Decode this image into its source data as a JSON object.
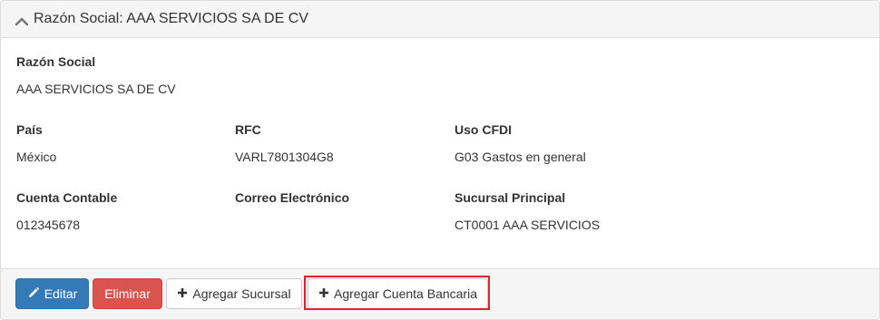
{
  "panel": {
    "title": "Razón Social: AAA SERVICIOS SA DE CV",
    "collapse_icon": "chevron-up-icon"
  },
  "fields": {
    "razon_social": {
      "label": "Razón Social",
      "value": "AAA SERVICIOS SA DE CV"
    },
    "pais": {
      "label": "País",
      "value": "México"
    },
    "rfc": {
      "label": "RFC",
      "value": "VARL7801304G8"
    },
    "uso_cfdi": {
      "label": "Uso CFDI",
      "value": "G03 Gastos en general"
    },
    "cuenta_contable": {
      "label": "Cuenta Contable",
      "value": "012345678"
    },
    "correo": {
      "label": "Correo Electrónico",
      "value": ""
    },
    "sucursal_principal": {
      "label": "Sucursal Principal",
      "value": "CT0001 AAA SERVICIOS"
    }
  },
  "footer": {
    "edit_label": "Editar",
    "edit_icon": "pencil-icon",
    "delete_label": "Eliminar",
    "add_branch_label": "Agregar Sucursal",
    "add_bank_account_label": "Agregar Cuenta Bancaria",
    "add_icon": "plus-icon"
  },
  "colors": {
    "primary": "#337ab7",
    "danger": "#d9534f",
    "highlight": "#e3202b",
    "heading_bg": "#f5f5f5"
  }
}
